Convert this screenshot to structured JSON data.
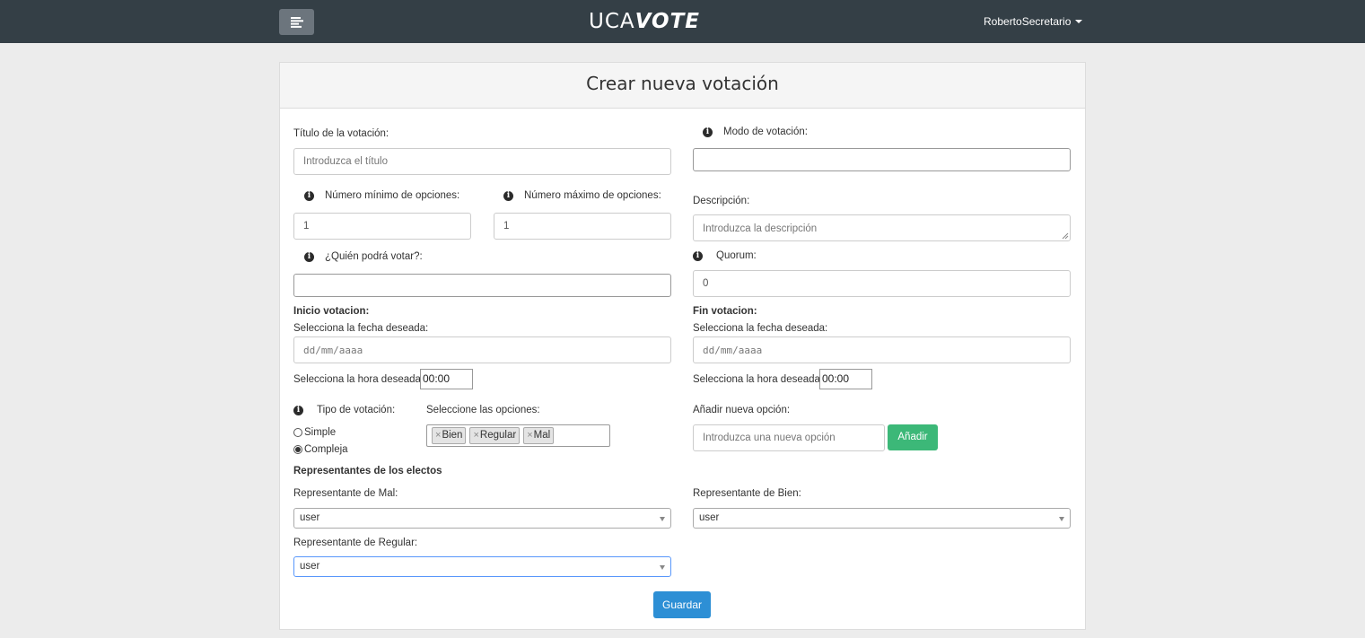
{
  "navbar": {
    "brand_light": "UCA",
    "brand_bold": "VOTE",
    "user_name": "RobertoSecretario"
  },
  "page": {
    "title": "Crear nueva votación"
  },
  "form": {
    "titulo_label": "Título de la votación:",
    "titulo_placeholder": "Introduzca el título",
    "modo_label": "Modo de votación:",
    "modo_value": "",
    "min_label": "Número mínimo de opciones:",
    "min_value": "1",
    "max_label": "Número máximo de opciones:",
    "max_value": "1",
    "descripcion_label": "Descripción:",
    "descripcion_placeholder": "Introduzca la descripción",
    "quien_label": "¿Quién podrá votar?:",
    "quien_value": "",
    "quorum_label": "Quorum:",
    "quorum_value": "0",
    "inicio_heading": "Inicio votacion:",
    "inicio_fecha_label": "Selecciona la fecha deseada:",
    "inicio_fecha_placeholder": "dd/mm/aaaa",
    "inicio_hora_label": "Selecciona la hora deseada:",
    "inicio_hora_value": "00:00",
    "fin_heading": "Fin votacion:",
    "fin_fecha_label": "Selecciona la fecha deseada:",
    "fin_fecha_placeholder": "dd/mm/aaaa",
    "fin_hora_label": "Selecciona la hora deseada:",
    "fin_hora_value": "00:00",
    "tipo_label": "Tipo de votación:",
    "tipo_options": [
      {
        "label": "Simple",
        "selected": false
      },
      {
        "label": "Compleja",
        "selected": true
      }
    ],
    "opciones_label": "Seleccione las opciones:",
    "opciones_tags": [
      "Bien",
      "Regular",
      "Mal"
    ],
    "tag_remove_glyph": "×",
    "nueva_opcion_label": "Añadir nueva opción:",
    "nueva_opcion_placeholder": "Introduzca una nueva opción",
    "add_button": "Añadir",
    "representantes_heading": "Representantes de los electos",
    "rep_mal_label": "Representante de Mal:",
    "rep_mal_value": "user",
    "rep_bien_label": "Representante de Bien:",
    "rep_bien_value": "user",
    "rep_regular_label": "Representante de Regular:",
    "rep_regular_value": "user",
    "save_button": "Guardar"
  },
  "colors": {
    "navbar": "#343f46",
    "add_button": "#3cb878",
    "save_button": "#2d8fd5"
  }
}
